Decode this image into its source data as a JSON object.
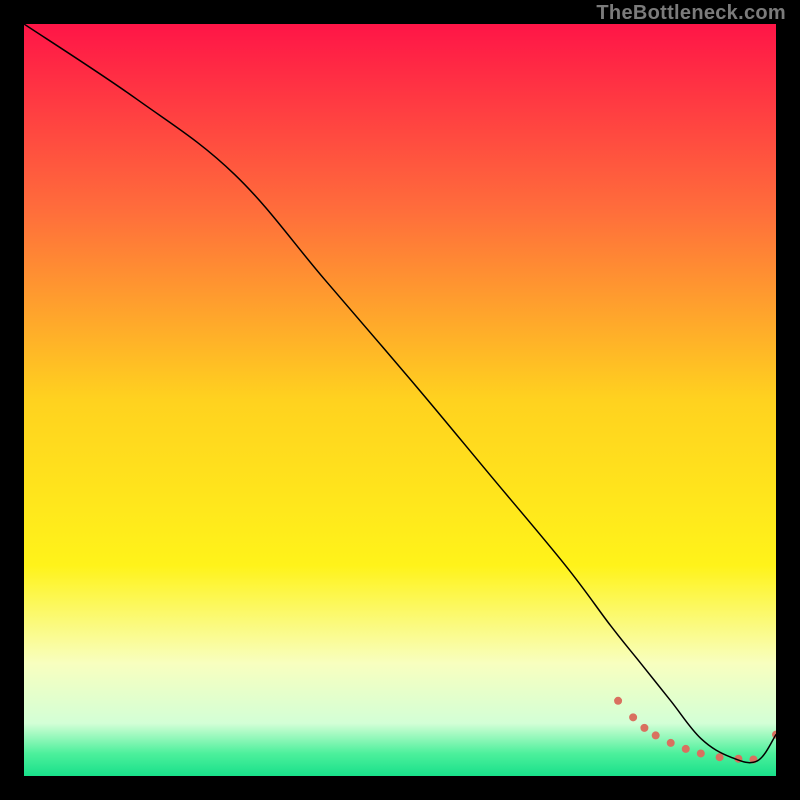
{
  "watermark": {
    "text": "TheBottleneck.com"
  },
  "chart_data": {
    "type": "line",
    "title": "",
    "xlabel": "",
    "ylabel": "",
    "xlim": [
      0,
      100
    ],
    "ylim": [
      0,
      100
    ],
    "grid": false,
    "legend": false,
    "background": {
      "type": "vertical-gradient",
      "stops": [
        {
          "offset": 0.0,
          "color": "#ff1547"
        },
        {
          "offset": 0.25,
          "color": "#ff6e3b"
        },
        {
          "offset": 0.5,
          "color": "#ffd21f"
        },
        {
          "offset": 0.72,
          "color": "#fff31a"
        },
        {
          "offset": 0.85,
          "color": "#f8ffbf"
        },
        {
          "offset": 0.93,
          "color": "#d3ffd6"
        },
        {
          "offset": 0.97,
          "color": "#4df09c"
        },
        {
          "offset": 1.0,
          "color": "#18e08a"
        }
      ]
    },
    "series": [
      {
        "name": "main-curve",
        "color": "#000000",
        "stroke_width": 1.5,
        "x": [
          0.0,
          15.0,
          28.0,
          40.0,
          52.0,
          62.0,
          72.0,
          78.0,
          82.0,
          86.0,
          90.0,
          94.0,
          97.5,
          100.0
        ],
        "y": [
          100.0,
          90.0,
          80.0,
          66.0,
          52.0,
          40.0,
          28.0,
          20.0,
          15.0,
          10.0,
          5.0,
          2.5,
          2.0,
          5.5
        ]
      }
    ],
    "markers": [
      {
        "name": "marker-segment",
        "color": "#d9705f",
        "radius": 4,
        "x": [
          79.0,
          81.0,
          82.5,
          84.0,
          86.0,
          88.0,
          90.0,
          92.5,
          95.0,
          97.0,
          100.0
        ],
        "y": [
          10.0,
          7.8,
          6.4,
          5.4,
          4.4,
          3.6,
          3.0,
          2.5,
          2.3,
          2.2,
          5.5
        ]
      }
    ]
  }
}
